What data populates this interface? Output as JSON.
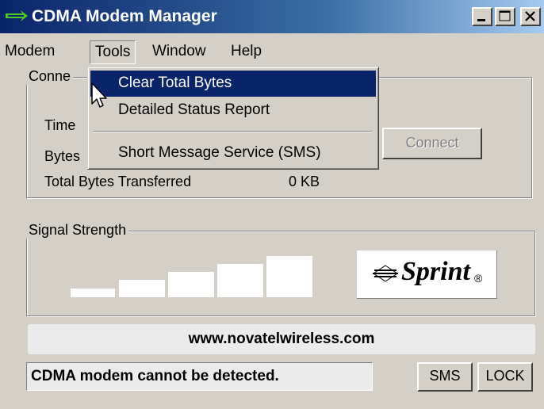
{
  "window": {
    "title": "CDMA Modem Manager"
  },
  "menubar": {
    "modem": "Modem",
    "tools": "Tools",
    "window": "Window",
    "help": "Help"
  },
  "tools_menu": {
    "items": [
      "Clear Total Bytes",
      "Detailed Status Report",
      "Short Message Service (SMS)"
    ],
    "highlighted": "Clear Total Bytes"
  },
  "connection": {
    "legend": "Conne",
    "time_label": "Time",
    "bytes_label": "Bytes",
    "total_bytes_label": "Total Bytes Transferred",
    "total_bytes_value": "0 KB",
    "connect_button": "Connect"
  },
  "signal": {
    "legend": "Signal Strength",
    "bars_total": 5,
    "bars_lit": 0,
    "brand": "Sprint",
    "brand_mark": "®"
  },
  "url": "www.novatelwireless.com",
  "status": {
    "message": "CDMA modem cannot be detected.",
    "sms_button": "SMS",
    "lock_button": "LOCK"
  },
  "colors": {
    "titlebar_start": "#0a246a",
    "titlebar_end": "#a6caf0",
    "menu_highlight": "#0a246a",
    "logo_green": "#4ccc22",
    "window_bg": "#d4d0c8"
  }
}
